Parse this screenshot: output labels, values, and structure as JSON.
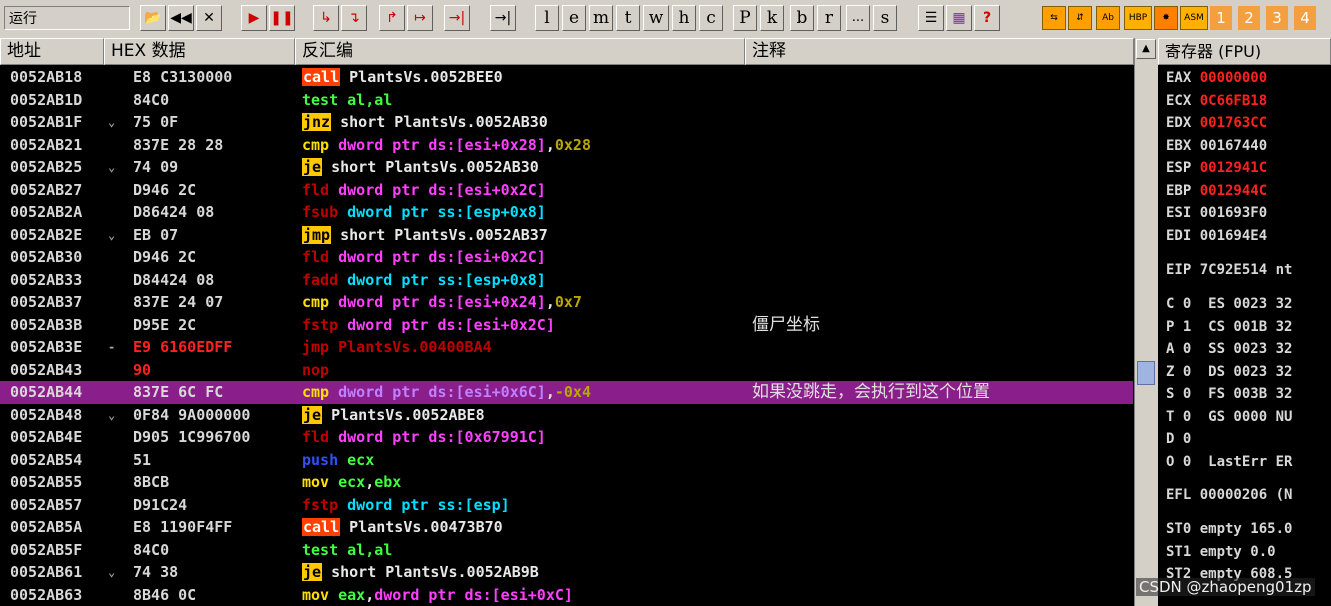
{
  "toolbar": {
    "status": "运行",
    "buttons": [
      "📂",
      "◀◀",
      "✕",
      "▶",
      "❚❚",
      "↳",
      "↴",
      "↱",
      "↦",
      "→|"
    ],
    "letters": [
      "l",
      "e",
      "m",
      "t",
      "w",
      "h",
      "c",
      "P",
      "k",
      "b",
      "r",
      "...",
      "s"
    ],
    "list_icon": "☰",
    "grid_icon": "▦",
    "help_icon": "?",
    "asm_buttons": [
      "⇆",
      "⇵",
      "Ab",
      "HBP",
      "✸",
      "ASM"
    ],
    "numbers": [
      "1",
      "2",
      "3",
      "4"
    ]
  },
  "headers": {
    "address": "地址",
    "hex": "HEX 数据",
    "disasm": "反汇编",
    "comment": "注释"
  },
  "rows": [
    {
      "addr": "0052AB18",
      "mark": "",
      "hex": "E8 C3130000",
      "parts": [
        {
          "t": "call",
          "c": "bg-red"
        },
        {
          "t": " PlantsVs.0052BEE0",
          "c": "c-white"
        }
      ],
      "comment": ""
    },
    {
      "addr": "0052AB1D",
      "mark": "",
      "hex": "84C0",
      "parts": [
        {
          "t": "test al,al",
          "c": "c-green"
        }
      ],
      "comment": ""
    },
    {
      "addr": "0052AB1F",
      "mark": "⌄",
      "hex": "75 0F",
      "parts": [
        {
          "t": "jnz",
          "c": "bg-yel"
        },
        {
          "t": " short PlantsVs.0052AB30",
          "c": "c-white"
        }
      ],
      "comment": ""
    },
    {
      "addr": "0052AB21",
      "mark": "",
      "hex": "837E 28 28",
      "parts": [
        {
          "t": "cmp ",
          "c": "c-yellow"
        },
        {
          "t": "dword ptr ds:[esi+0x28]",
          "c": "c-mag"
        },
        {
          "t": ",",
          "c": "c-white"
        },
        {
          "t": "0x28",
          "c": "c-olive"
        }
      ],
      "comment": ""
    },
    {
      "addr": "0052AB25",
      "mark": "⌄",
      "hex": "74 09",
      "parts": [
        {
          "t": "je",
          "c": "bg-yel"
        },
        {
          "t": " short PlantsVs.0052AB30",
          "c": "c-white"
        }
      ],
      "comment": ""
    },
    {
      "addr": "0052AB27",
      "mark": "",
      "hex": "D946 2C",
      "parts": [
        {
          "t": "fld ",
          "c": "c-dkred"
        },
        {
          "t": "dword ptr ds:[esi+0x2C]",
          "c": "c-mag"
        }
      ],
      "comment": ""
    },
    {
      "addr": "0052AB2A",
      "mark": "",
      "hex": "D86424 08",
      "parts": [
        {
          "t": "fsub ",
          "c": "c-dkred"
        },
        {
          "t": "dword ptr ss:[esp+0x8]",
          "c": "c-cyan"
        }
      ],
      "comment": ""
    },
    {
      "addr": "0052AB2E",
      "mark": "⌄",
      "hex": "EB 07",
      "parts": [
        {
          "t": "jmp",
          "c": "bg-yel"
        },
        {
          "t": " short PlantsVs.0052AB37",
          "c": "c-white"
        }
      ],
      "comment": ""
    },
    {
      "addr": "0052AB30",
      "mark": "",
      "hex": "D946 2C",
      "parts": [
        {
          "t": "fld ",
          "c": "c-dkred"
        },
        {
          "t": "dword ptr ds:[esi+0x2C]",
          "c": "c-mag"
        }
      ],
      "comment": ""
    },
    {
      "addr": "0052AB33",
      "mark": "",
      "hex": "D84424 08",
      "parts": [
        {
          "t": "fadd ",
          "c": "c-dkred"
        },
        {
          "t": "dword ptr ss:[esp+0x8]",
          "c": "c-cyan"
        }
      ],
      "comment": ""
    },
    {
      "addr": "0052AB37",
      "mark": "",
      "hex": "837E 24 07",
      "parts": [
        {
          "t": "cmp ",
          "c": "c-yellow"
        },
        {
          "t": "dword ptr ds:[esi+0x24]",
          "c": "c-mag"
        },
        {
          "t": ",",
          "c": "c-white"
        },
        {
          "t": "0x7",
          "c": "c-olive"
        }
      ],
      "comment": ""
    },
    {
      "addr": "0052AB3B",
      "mark": "",
      "hex": "D95E 2C",
      "parts": [
        {
          "t": "fstp ",
          "c": "c-dkred"
        },
        {
          "t": "dword ptr ds:[esi+0x2C]",
          "c": "c-mag"
        }
      ],
      "comment": "僵尸坐标"
    },
    {
      "addr": "0052AB3E",
      "mark": "-",
      "hex": "E9 6160EDFF",
      "hexc": "c-red",
      "parts": [
        {
          "t": "jmp PlantsVs.00400BA4",
          "c": "c-dkred"
        }
      ],
      "comment": ""
    },
    {
      "addr": "0052AB43",
      "mark": "",
      "hex": "90",
      "hexc": "c-red",
      "parts": [
        {
          "t": "nop",
          "c": "c-dkred"
        }
      ],
      "comment": ""
    },
    {
      "addr": "0052AB44",
      "mark": "",
      "hex": "837E 6C FC",
      "hl": true,
      "parts": [
        {
          "t": "cmp ",
          "c": "c-yellow"
        },
        {
          "t": "dword ptr ds:[esi+0x6C]",
          "c": "c-purp"
        },
        {
          "t": ",",
          "c": "c-white"
        },
        {
          "t": "-0x4",
          "c": "c-olive"
        }
      ],
      "comment": "如果没跳走，会执行到这个位置"
    },
    {
      "addr": "0052AB48",
      "mark": "⌄",
      "hex": "0F84 9A000000",
      "parts": [
        {
          "t": "je",
          "c": "bg-yel"
        },
        {
          "t": " PlantsVs.0052ABE8",
          "c": "c-white"
        }
      ],
      "comment": ""
    },
    {
      "addr": "0052AB4E",
      "mark": "",
      "hex": "D905 1C996700",
      "parts": [
        {
          "t": "fld ",
          "c": "c-dkred"
        },
        {
          "t": "dword ptr ds:[0x67991C]",
          "c": "c-mag"
        }
      ],
      "comment": ""
    },
    {
      "addr": "0052AB54",
      "mark": "",
      "hex": "51",
      "parts": [
        {
          "t": "push ",
          "c": "c-blue"
        },
        {
          "t": "ecx",
          "c": "c-green"
        }
      ],
      "comment": ""
    },
    {
      "addr": "0052AB55",
      "mark": "",
      "hex": "8BCB",
      "parts": [
        {
          "t": "mov ",
          "c": "c-yellow"
        },
        {
          "t": "ecx",
          "c": "c-green"
        },
        {
          "t": ",",
          "c": "c-white"
        },
        {
          "t": "ebx",
          "c": "c-green"
        }
      ],
      "comment": ""
    },
    {
      "addr": "0052AB57",
      "mark": "",
      "hex": "D91C24",
      "parts": [
        {
          "t": "fstp ",
          "c": "c-dkred"
        },
        {
          "t": "dword ptr ss:[esp]",
          "c": "c-cyan"
        }
      ],
      "comment": ""
    },
    {
      "addr": "0052AB5A",
      "mark": "",
      "hex": "E8 1190F4FF",
      "parts": [
        {
          "t": "call",
          "c": "bg-red"
        },
        {
          "t": " PlantsVs.00473B70",
          "c": "c-white"
        }
      ],
      "comment": ""
    },
    {
      "addr": "0052AB5F",
      "mark": "",
      "hex": "84C0",
      "parts": [
        {
          "t": "test al,al",
          "c": "c-green"
        }
      ],
      "comment": ""
    },
    {
      "addr": "0052AB61",
      "mark": "⌄",
      "hex": "74 38",
      "parts": [
        {
          "t": "je",
          "c": "bg-yel"
        },
        {
          "t": " short PlantsVs.0052AB9B",
          "c": "c-white"
        }
      ],
      "comment": ""
    },
    {
      "addr": "0052AB63",
      "mark": "",
      "hex": "8B46 0C",
      "parts": [
        {
          "t": "mov ",
          "c": "c-yellow"
        },
        {
          "t": "eax",
          "c": "c-green"
        },
        {
          "t": ",",
          "c": "c-white"
        },
        {
          "t": "dword ptr ds:[esi+0xC]",
          "c": "c-mag"
        }
      ],
      "comment": ""
    }
  ],
  "registers": {
    "title": "寄存器 (FPU)",
    "gp": [
      {
        "name": "EAX",
        "value": "00000000",
        "changed": true
      },
      {
        "name": "ECX",
        "value": "0C66FB18",
        "changed": true
      },
      {
        "name": "EDX",
        "value": "001763CC",
        "changed": true
      },
      {
        "name": "EBX",
        "value": "00167440",
        "changed": false
      },
      {
        "name": "ESP",
        "value": "0012941C",
        "changed": true
      },
      {
        "name": "EBP",
        "value": "0012944C",
        "changed": true
      },
      {
        "name": "ESI",
        "value": "001693F0",
        "changed": false
      },
      {
        "name": "EDI",
        "value": "001694E4",
        "changed": false
      }
    ],
    "eip": "EIP 7C92E514 nt",
    "flags": [
      "C 0  ES 0023 32",
      "P 1  CS 001B 32",
      "A 0  SS 0023 32",
      "Z 0  DS 0023 32",
      "S 0  FS 003B 32",
      "T 0  GS 0000 NU",
      "D 0",
      "O 0  LastErr ER"
    ],
    "efl": "EFL 00000206 (N",
    "fpu": [
      "ST0 empty 165.0",
      "ST1 empty 0.0",
      "ST2 empty 608.5"
    ]
  },
  "watermark": "CSDN @zhaopeng01zp"
}
